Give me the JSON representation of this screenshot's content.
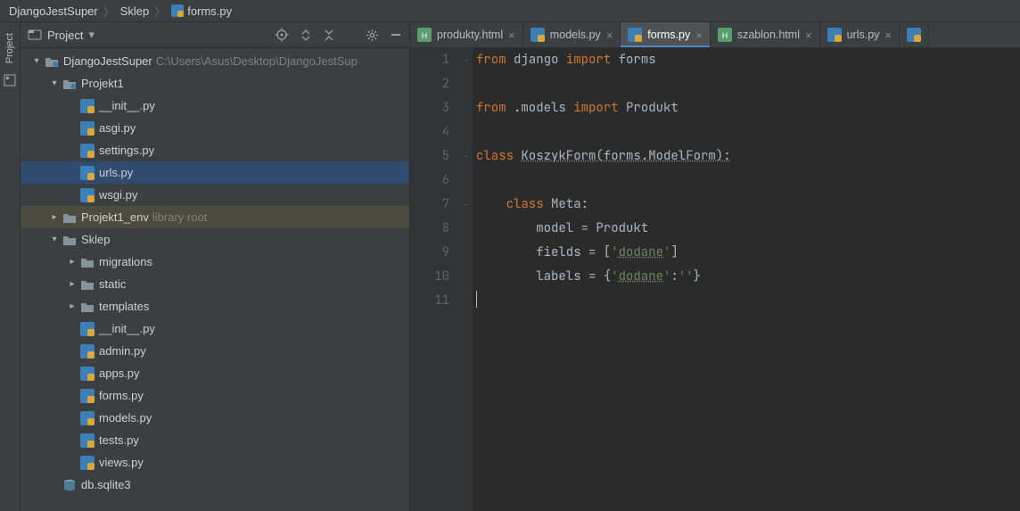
{
  "breadcrumb": {
    "root": "DjangoJestSuper",
    "folder": "Sklep",
    "file": "forms.py"
  },
  "sidebar_strip": {
    "project_label": "Project"
  },
  "project_panel": {
    "title": "Project",
    "icons": {
      "locate": "locate",
      "expand": "expand-all",
      "collapse": "collapse-all",
      "settings": "settings",
      "hide": "hide"
    }
  },
  "tree": [
    {
      "depth": 0,
      "arrow": "down",
      "icon": "dir-root",
      "label": "DjangoJestSuper",
      "hint": "C:\\Users\\Asus\\Desktop\\DjangoJestSup"
    },
    {
      "depth": 1,
      "arrow": "down",
      "icon": "dir-mod",
      "label": "Projekt1"
    },
    {
      "depth": 2,
      "arrow": "none",
      "icon": "py",
      "label": "__init__.py"
    },
    {
      "depth": 2,
      "arrow": "none",
      "icon": "py",
      "label": "asgi.py"
    },
    {
      "depth": 2,
      "arrow": "none",
      "icon": "py",
      "label": "settings.py"
    },
    {
      "depth": 2,
      "arrow": "none",
      "icon": "py",
      "label": "urls.py",
      "sel": true
    },
    {
      "depth": 2,
      "arrow": "none",
      "icon": "py",
      "label": "wsgi.py"
    },
    {
      "depth": 1,
      "arrow": "right",
      "icon": "dir",
      "label": "Projekt1_env",
      "hint": "library root",
      "hi": true
    },
    {
      "depth": 1,
      "arrow": "down",
      "icon": "dir",
      "label": "Sklep"
    },
    {
      "depth": 2,
      "arrow": "right",
      "icon": "dir",
      "label": "migrations"
    },
    {
      "depth": 2,
      "arrow": "right",
      "icon": "dir",
      "label": "static"
    },
    {
      "depth": 2,
      "arrow": "right",
      "icon": "dir",
      "label": "templates"
    },
    {
      "depth": 2,
      "arrow": "none",
      "icon": "py",
      "label": "__init__.py"
    },
    {
      "depth": 2,
      "arrow": "none",
      "icon": "py",
      "label": "admin.py"
    },
    {
      "depth": 2,
      "arrow": "none",
      "icon": "py",
      "label": "apps.py"
    },
    {
      "depth": 2,
      "arrow": "none",
      "icon": "py",
      "label": "forms.py"
    },
    {
      "depth": 2,
      "arrow": "none",
      "icon": "py",
      "label": "models.py"
    },
    {
      "depth": 2,
      "arrow": "none",
      "icon": "py",
      "label": "tests.py"
    },
    {
      "depth": 2,
      "arrow": "none",
      "icon": "py",
      "label": "views.py"
    },
    {
      "depth": 1,
      "arrow": "none",
      "icon": "db",
      "label": "db.sqlite3"
    }
  ],
  "tabs": [
    {
      "icon": "html",
      "label": "produkty.html",
      "active": false
    },
    {
      "icon": "py",
      "label": "models.py",
      "active": false
    },
    {
      "icon": "py",
      "label": "forms.py",
      "active": true
    },
    {
      "icon": "html",
      "label": "szablon.html",
      "active": false
    },
    {
      "icon": "py",
      "label": "urls.py",
      "active": false
    }
  ],
  "editor": {
    "lines": [
      {
        "n": 1,
        "fold": "−",
        "html": "<span class='kw'>from</span> django <span class='kw'>import</span> forms"
      },
      {
        "n": 2,
        "fold": "",
        "html": ""
      },
      {
        "n": 3,
        "fold": "",
        "html": "<span class='kw'>from</span> .models <span class='kw'>import</span> Produkt"
      },
      {
        "n": 4,
        "fold": "",
        "html": ""
      },
      {
        "n": 5,
        "fold": "−",
        "html": "<span class='kw'>class</span> <span class='sq-under'>KoszykForm(forms.ModelForm):</span>"
      },
      {
        "n": 6,
        "fold": "",
        "html": ""
      },
      {
        "n": 7,
        "fold": "−",
        "html": "    <span class='kw'>class</span> Meta:"
      },
      {
        "n": 8,
        "fold": "",
        "html": "        model = Produkt"
      },
      {
        "n": 9,
        "fold": "",
        "html": "        fields = [<span class='str'>'<span class='sq-under'>dodane</span>'</span>]"
      },
      {
        "n": 10,
        "fold": "",
        "html": "        labels = {<span class='str'>'<span class='sq-under'>dodane</span>'</span>:<span class='str'>''</span>}"
      },
      {
        "n": 11,
        "fold": "",
        "html": "<span class='caret'></span>"
      }
    ]
  }
}
